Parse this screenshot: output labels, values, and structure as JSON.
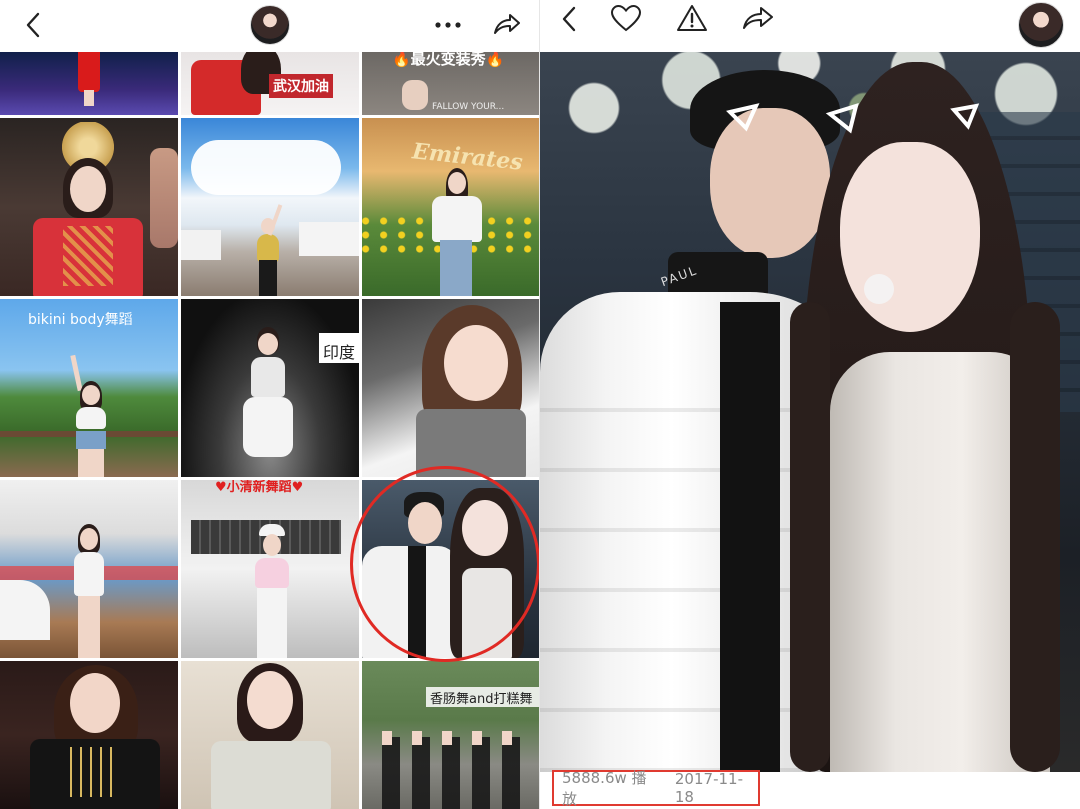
{
  "left_panel": {
    "grid_captions": {
      "wuhan": "武汉加油",
      "top_right": "🔥最火变装秀🔥",
      "top_right_sub": "FALLOW YOUR...",
      "emirates": "Emirates",
      "bikini": "bikini body舞蹈",
      "india": "印度",
      "xiaoqingxin": "♥小清新舞蹈♥",
      "sausage": "香肠舞and打糕舞"
    }
  },
  "right_panel": {
    "stats": {
      "plays": "5888.6w 播放",
      "date": "2017-11-18"
    },
    "jacket_text": "PAUL"
  }
}
